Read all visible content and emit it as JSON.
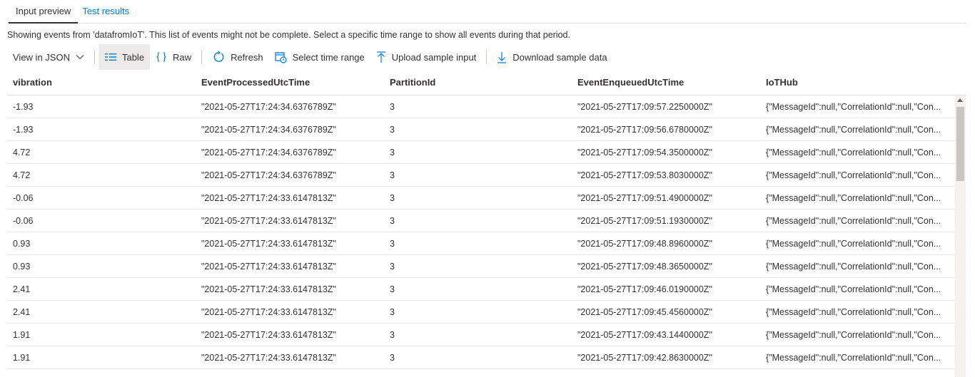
{
  "tabs": [
    {
      "label": "Input preview",
      "active": true
    },
    {
      "label": "Test results",
      "active": false
    }
  ],
  "info_text": "Showing events from 'datafromIoT'. This list of events might not be complete. Select a specific time range to show all events during that period.",
  "toolbar": {
    "view_dropdown": "View in JSON",
    "table_label": "Table",
    "raw_label": "Raw",
    "refresh_label": "Refresh",
    "select_time_range_label": "Select time range",
    "upload_label": "Upload sample input",
    "download_label": "Download sample data"
  },
  "accent_color": "#0078d4",
  "columns": [
    "vibration",
    "EventProcessedUtcTime",
    "PartitionId",
    "EventEnqueuedUtcTime",
    "IoTHub"
  ],
  "rows": [
    [
      "-1.93",
      "\"2021-05-27T17:24:34.6376789Z\"",
      "3",
      "\"2021-05-27T17:09:57.2250000Z\"",
      "{\"MessageId\":null,\"CorrelationId\":null,\"Con..."
    ],
    [
      "-1.93",
      "\"2021-05-27T17:24:34.6376789Z\"",
      "3",
      "\"2021-05-27T17:09:56.6780000Z\"",
      "{\"MessageId\":null,\"CorrelationId\":null,\"Con..."
    ],
    [
      "4.72",
      "\"2021-05-27T17:24:34.6376789Z\"",
      "3",
      "\"2021-05-27T17:09:54.3500000Z\"",
      "{\"MessageId\":null,\"CorrelationId\":null,\"Con..."
    ],
    [
      "4.72",
      "\"2021-05-27T17:24:34.6376789Z\"",
      "3",
      "\"2021-05-27T17:09:53.8030000Z\"",
      "{\"MessageId\":null,\"CorrelationId\":null,\"Con..."
    ],
    [
      "-0.06",
      "\"2021-05-27T17:24:33.6147813Z\"",
      "3",
      "\"2021-05-27T17:09:51.4900000Z\"",
      "{\"MessageId\":null,\"CorrelationId\":null,\"Con..."
    ],
    [
      "-0.06",
      "\"2021-05-27T17:24:33.6147813Z\"",
      "3",
      "\"2021-05-27T17:09:51.1930000Z\"",
      "{\"MessageId\":null,\"CorrelationId\":null,\"Con..."
    ],
    [
      "0.93",
      "\"2021-05-27T17:24:33.6147813Z\"",
      "3",
      "\"2021-05-27T17:09:48.8960000Z\"",
      "{\"MessageId\":null,\"CorrelationId\":null,\"Con..."
    ],
    [
      "0.93",
      "\"2021-05-27T17:24:33.6147813Z\"",
      "3",
      "\"2021-05-27T17:09:48.3650000Z\"",
      "{\"MessageId\":null,\"CorrelationId\":null,\"Con..."
    ],
    [
      "2.41",
      "\"2021-05-27T17:24:33.6147813Z\"",
      "3",
      "\"2021-05-27T17:09:46.0190000Z\"",
      "{\"MessageId\":null,\"CorrelationId\":null,\"Con..."
    ],
    [
      "2.41",
      "\"2021-05-27T17:24:33.6147813Z\"",
      "3",
      "\"2021-05-27T17:09:45.4560000Z\"",
      "{\"MessageId\":null,\"CorrelationId\":null,\"Con..."
    ],
    [
      "1.91",
      "\"2021-05-27T17:24:33.6147813Z\"",
      "3",
      "\"2021-05-27T17:09:43.1440000Z\"",
      "{\"MessageId\":null,\"CorrelationId\":null,\"Con..."
    ],
    [
      "1.91",
      "\"2021-05-27T17:24:33.6147813Z\"",
      "3",
      "\"2021-05-27T17:09:42.8630000Z\"",
      "{\"MessageId\":null,\"CorrelationId\":null,\"Con..."
    ]
  ]
}
